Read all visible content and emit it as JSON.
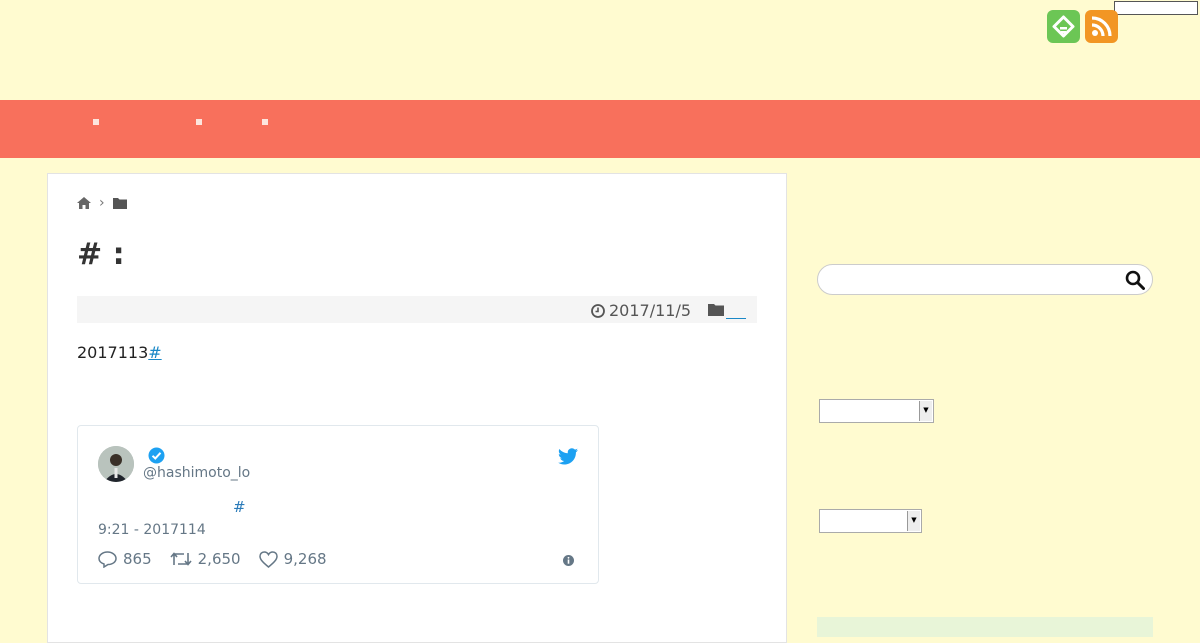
{
  "header": {
    "icons": [
      "feedly-icon",
      "rss-icon"
    ],
    "colors": {
      "background": "#fffbd0",
      "nav": "#f8705c",
      "feedly": "#6cc655",
      "rss": "#f29624"
    }
  },
  "nav": {
    "items": [
      "",
      "",
      ""
    ]
  },
  "article": {
    "breadcrumb": {
      "icons": [
        "home-icon",
        "chevron-right-icon",
        "folder-icon"
      ]
    },
    "title": "# :",
    "meta": {
      "date": "2017/11/5",
      "category": ""
    },
    "lead": {
      "text": "2017113",
      "hashtag": "#"
    }
  },
  "tweet": {
    "handle": "@hashimoto_lo",
    "hashtag": "#",
    "timestamp": "9:21 - 2017114",
    "replies": "865",
    "retweets": "2,650",
    "likes": "9,268"
  },
  "sidebar": {
    "search": {
      "value": ""
    },
    "dropdown1": {
      "selected": ""
    },
    "dropdown2": {
      "selected": ""
    }
  }
}
